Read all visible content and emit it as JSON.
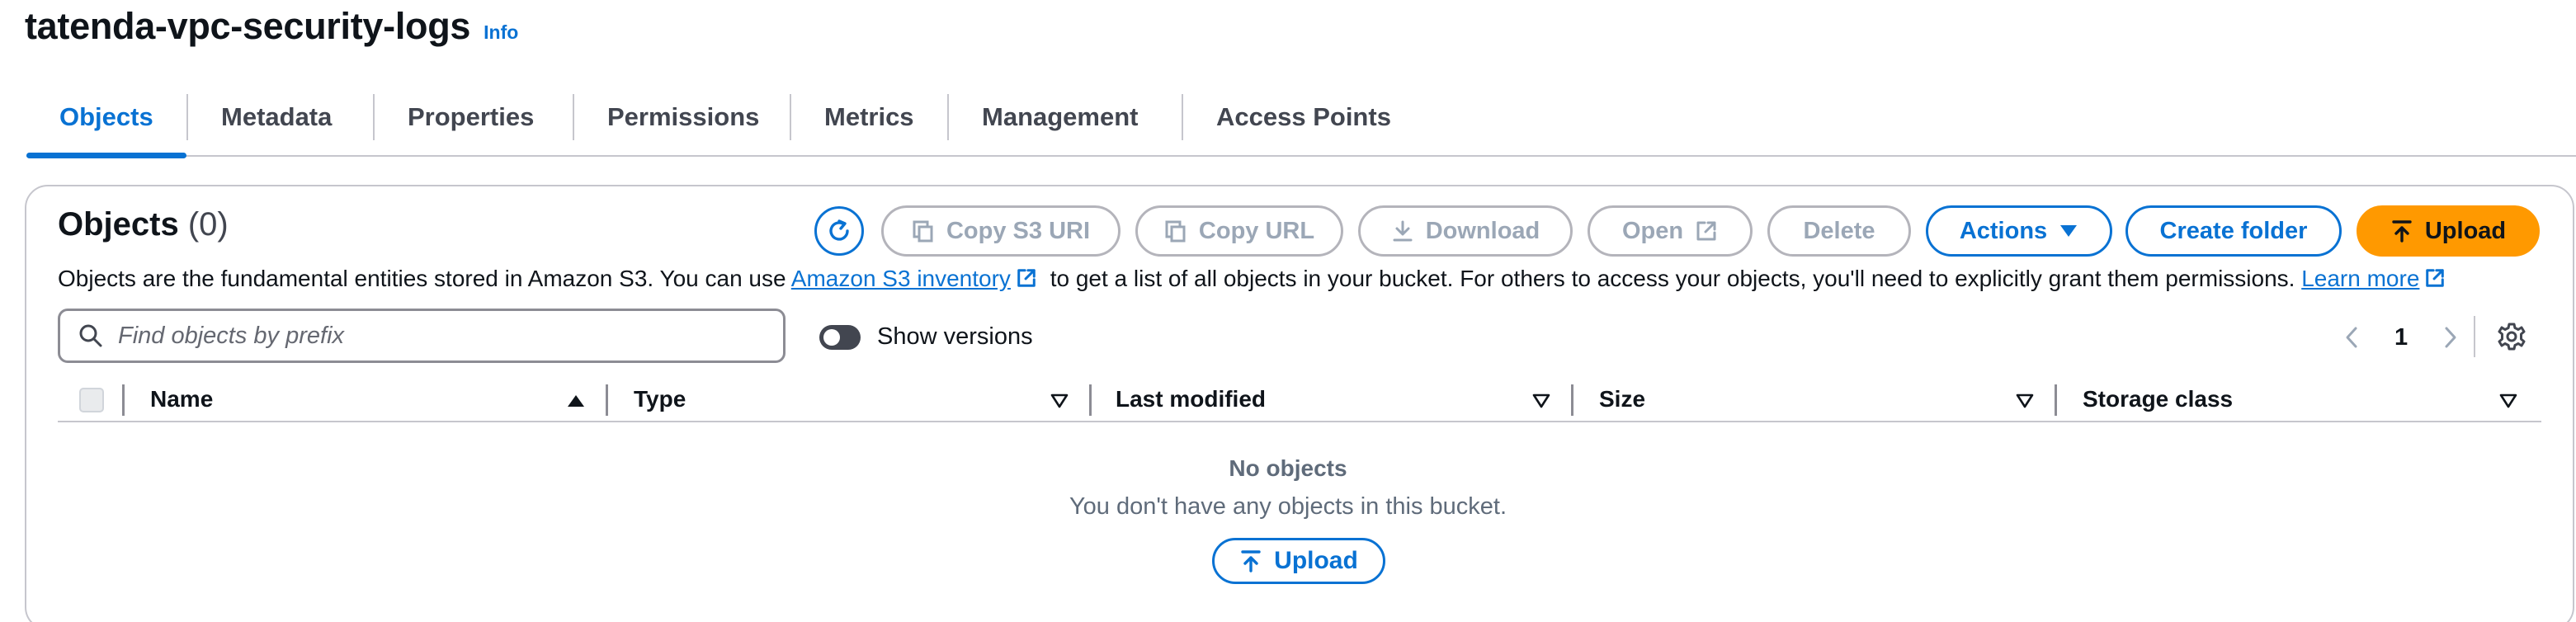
{
  "bucket": {
    "name": "tatenda-vpc-security-logs",
    "info_link": "Info"
  },
  "tabs": [
    {
      "label": "Objects",
      "active": true
    },
    {
      "label": "Metadata",
      "active": false
    },
    {
      "label": "Properties",
      "active": false
    },
    {
      "label": "Permissions",
      "active": false
    },
    {
      "label": "Metrics",
      "active": false
    },
    {
      "label": "Management",
      "active": false
    },
    {
      "label": "Access Points",
      "active": false
    }
  ],
  "objects_panel": {
    "title": "Objects",
    "count": "(0)",
    "description": {
      "text_1": "Objects are the fundamental entities stored in Amazon S3. You can use ",
      "link_1": "Amazon S3 inventory",
      "text_2": " to get a list of all objects in your bucket. For others to access your objects, you'll need to explicitly grant them permissions. ",
      "link_2": "Learn more"
    },
    "toolbar": {
      "copy_s3_uri": "Copy S3 URI",
      "copy_url": "Copy URL",
      "download": "Download",
      "open": "Open",
      "delete": "Delete",
      "actions": "Actions",
      "create_folder": "Create folder",
      "upload": "Upload"
    },
    "search": {
      "placeholder": "Find objects by prefix",
      "value": ""
    },
    "show_versions": {
      "label": "Show versions",
      "enabled": false
    },
    "pagination": {
      "current_page": "1"
    },
    "columns": [
      "Name",
      "Type",
      "Last modified",
      "Size",
      "Storage class"
    ],
    "empty_state": {
      "title": "No objects",
      "message": "You don't have any objects in this bucket.",
      "upload_label": "Upload"
    }
  },
  "colors": {
    "link_blue": "#0972d3",
    "upload_orange": "#ff9900",
    "disabled_gray": "#9ba7b6",
    "border_gray": "#c6c6cd"
  },
  "icons": [
    "refresh-icon",
    "copy-icon",
    "download-icon",
    "external-link-icon",
    "caret-down-icon",
    "upload-icon",
    "search-icon",
    "chevron-left-icon",
    "chevron-right-icon",
    "gear-icon",
    "sort-ascending-icon",
    "sort-descending-icon"
  ]
}
